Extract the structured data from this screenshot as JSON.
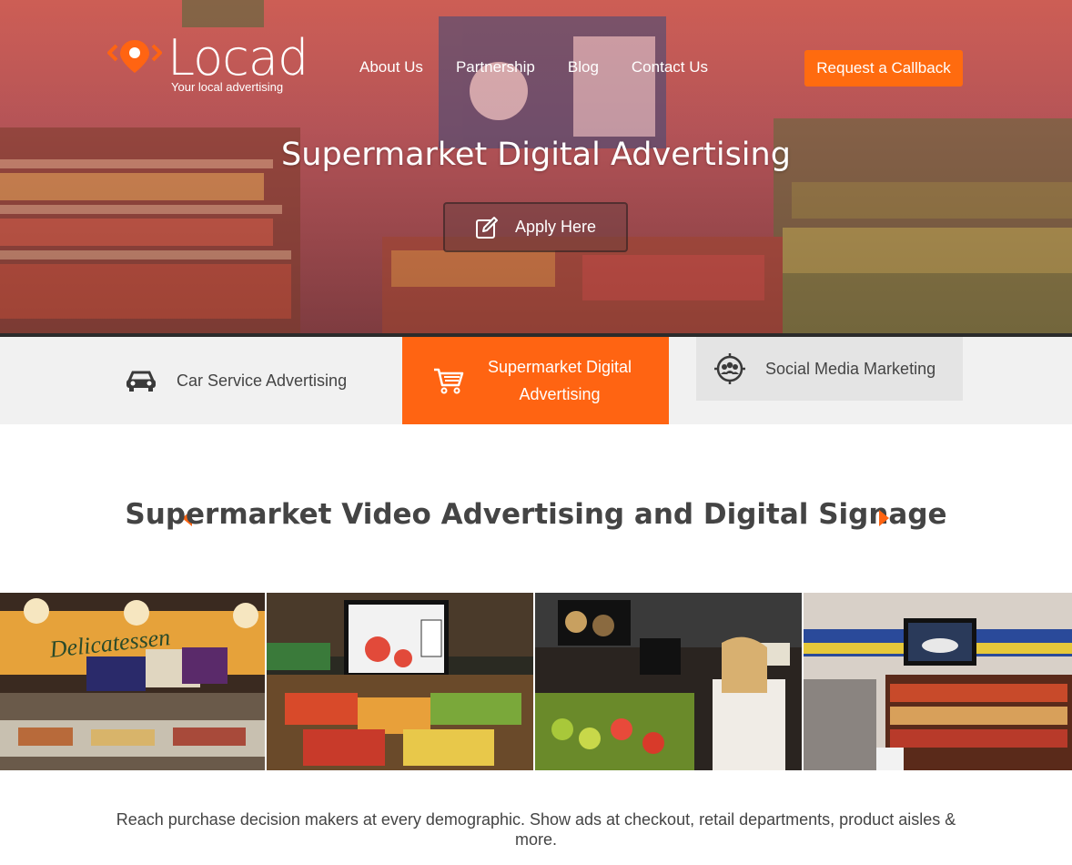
{
  "brand": {
    "name": "Locad",
    "tagline": "Your local advertising",
    "accent": "#ff6412"
  },
  "nav": {
    "items": [
      "About Us",
      "Partnership",
      "Blog",
      "Contact Us"
    ],
    "cta": "Request a Callback"
  },
  "hero": {
    "title": "Supermarket Digital Advertising",
    "apply": "Apply Here"
  },
  "tabs": [
    {
      "label": "Car Service Advertising",
      "icon": "car-icon",
      "active": false
    },
    {
      "label": "Supermarket Digital Advertising",
      "icon": "shopping-cart-icon",
      "active": true
    },
    {
      "label": "Social Media Marketing",
      "icon": "people-target-icon",
      "active": false
    }
  ],
  "section": {
    "title": "Supermarket Video Advertising and Digital Signage"
  },
  "gallery": [
    "delicatessen-photo",
    "produce-display-photo",
    "shopper-screens-photo",
    "deli-counter-photo"
  ],
  "description": "Reach purchase decision makers at every demographic. Show ads at checkout, retail departments, product aisles & more."
}
